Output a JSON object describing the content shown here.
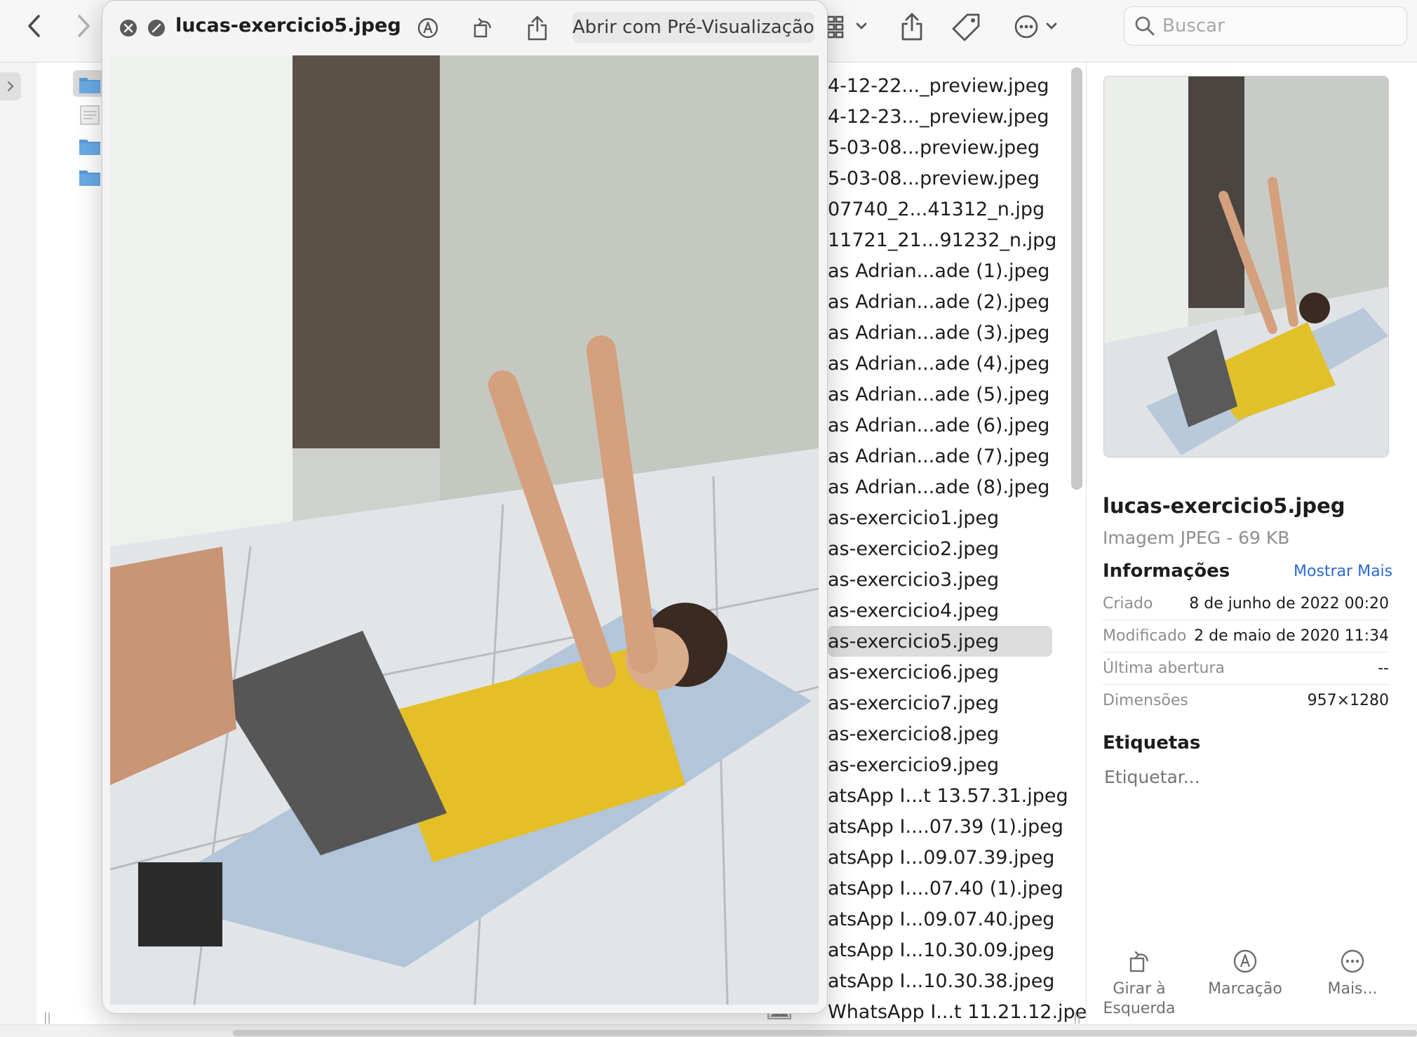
{
  "quicklook": {
    "title": "lucas-exercicio5.jpeg",
    "open_button": "Abrir com Pré-Visualização"
  },
  "search": {
    "placeholder": "Buscar"
  },
  "files": [
    {
      "name": "4-12-22..._preview.jpeg",
      "selected": false
    },
    {
      "name": "4-12-23..._preview.jpeg",
      "selected": false
    },
    {
      "name": "5-03-08...preview.jpeg",
      "selected": false
    },
    {
      "name": "5-03-08...preview.jpeg",
      "selected": false
    },
    {
      "name": "07740_2...41312_n.jpg",
      "selected": false
    },
    {
      "name": "11721_21...91232_n.jpg",
      "selected": false
    },
    {
      "name": "as Adrian...ade (1).jpeg",
      "selected": false
    },
    {
      "name": "as Adrian...ade (2).jpeg",
      "selected": false
    },
    {
      "name": "as Adrian...ade (3).jpeg",
      "selected": false
    },
    {
      "name": "as Adrian...ade (4).jpeg",
      "selected": false
    },
    {
      "name": "as Adrian...ade (5).jpeg",
      "selected": false
    },
    {
      "name": "as Adrian...ade (6).jpeg",
      "selected": false
    },
    {
      "name": "as Adrian...ade (7).jpeg",
      "selected": false
    },
    {
      "name": "as Adrian...ade (8).jpeg",
      "selected": false
    },
    {
      "name": "as-exercicio1.jpeg",
      "selected": false
    },
    {
      "name": "as-exercicio2.jpeg",
      "selected": false
    },
    {
      "name": "as-exercicio3.jpeg",
      "selected": false
    },
    {
      "name": "as-exercicio4.jpeg",
      "selected": false
    },
    {
      "name": "as-exercicio5.jpeg",
      "selected": true
    },
    {
      "name": "as-exercicio6.jpeg",
      "selected": false
    },
    {
      "name": "as-exercicio7.jpeg",
      "selected": false
    },
    {
      "name": "as-exercicio8.jpeg",
      "selected": false
    },
    {
      "name": "as-exercicio9.jpeg",
      "selected": false
    },
    {
      "name": "atsApp I...t 13.57.31.jpeg",
      "selected": false
    },
    {
      "name": "atsApp I....07.39 (1).jpeg",
      "selected": false
    },
    {
      "name": "atsApp I...09.07.39.jpeg",
      "selected": false
    },
    {
      "name": "atsApp I....07.40 (1).jpeg",
      "selected": false
    },
    {
      "name": "atsApp I...09.07.40.jpeg",
      "selected": false
    },
    {
      "name": "atsApp I...10.30.09.jpeg",
      "selected": false
    },
    {
      "name": "atsApp I...10.30.38.jpeg",
      "selected": false
    },
    {
      "name": "WhatsApp I...t 11.21.12.jpeg",
      "selected": false
    }
  ],
  "info": {
    "filename": "lucas-exercicio5.jpeg",
    "kind": "Imagem JPEG - 69 KB",
    "section_info": "Informações",
    "show_more": "Mostrar Mais",
    "rows": [
      {
        "key": "Criado",
        "value": "8 de junho de 2022 00:20"
      },
      {
        "key": "Modificado",
        "value": "2 de maio de 2020 11:34"
      },
      {
        "key": "Última abertura",
        "value": "--"
      },
      {
        "key": "Dimensões",
        "value": "957×1280"
      }
    ],
    "section_tags": "Etiquetas",
    "tags_placeholder": "Etiquetar..."
  },
  "actions": [
    {
      "label": "Girar à Esquerda",
      "icon": "rotate-left-icon"
    },
    {
      "label": "Marcação",
      "icon": "markup-icon"
    },
    {
      "label": "Mais...",
      "icon": "more-icon"
    }
  ]
}
